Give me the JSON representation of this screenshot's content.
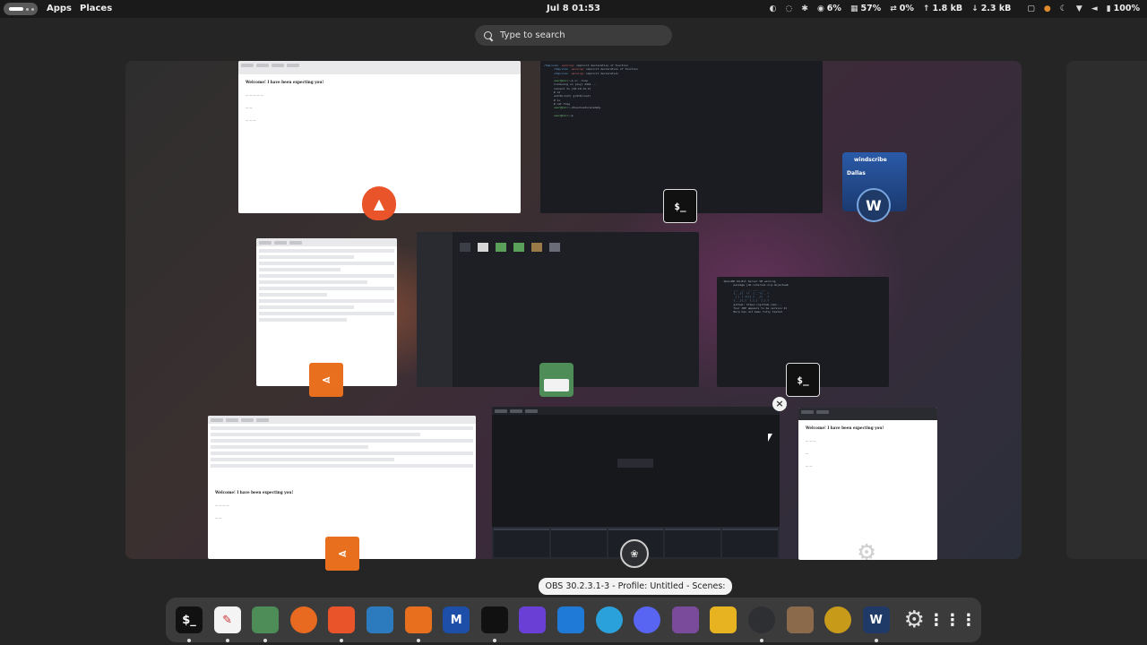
{
  "topbar": {
    "apps_label": "Apps",
    "places_label": "Places",
    "clock": "Jul 8  01:53",
    "tray": {
      "cpu": "6%",
      "mem": "57%",
      "swap": "0%",
      "net_up": "1.8 kB",
      "net_down": "2.3 kB",
      "battery": "100%"
    }
  },
  "search": {
    "placeholder": "Type to search"
  },
  "windows": {
    "brave_top": {
      "heading": "Welcome! I have been expecting you!"
    },
    "term_top": {
      "prompt_glyph": "$_"
    },
    "windscribe": {
      "brand": "windscribe",
      "location": "Dallas"
    },
    "term_burp": {
      "prompt_glyph": "$_"
    },
    "firefox_bottom": {
      "heading": "Welcome! I have been expecting you!"
    },
    "brave_right": {
      "heading": "Welcome! I have been expecting you!"
    }
  },
  "tooltip": "OBS 30.2.3.1-3 - Profile: Untitled - Scenes: Untitled",
  "dock": {
    "items": [
      {
        "name": "terminal",
        "glyph": "$_",
        "color": "#111111"
      },
      {
        "name": "text-editor",
        "glyph": "",
        "color": "#f4f4f4"
      },
      {
        "name": "files",
        "glyph": "",
        "color": "#4e8c58"
      },
      {
        "name": "firefox",
        "glyph": "",
        "color": "#e76a20"
      },
      {
        "name": "brave",
        "glyph": "",
        "color": "#e9542a"
      },
      {
        "name": "wireshark",
        "glyph": "",
        "color": "#2d7bbf"
      },
      {
        "name": "burp-suite-ce",
        "glyph": "",
        "color": "#e86f1d"
      },
      {
        "name": "maltego",
        "glyph": "M",
        "color": "#1d4fa8"
      },
      {
        "name": "burp-suite",
        "glyph": "",
        "color": "#111111"
      },
      {
        "name": "burp-pro",
        "glyph": "",
        "color": "#6a3fd6"
      },
      {
        "name": "vscode",
        "glyph": "",
        "color": "#1e7ad6"
      },
      {
        "name": "telegram",
        "glyph": "",
        "color": "#2aa1da"
      },
      {
        "name": "discord",
        "glyph": "",
        "color": "#5865f2"
      },
      {
        "name": "tor-browser",
        "glyph": "",
        "color": "#7a4b9a"
      },
      {
        "name": "virtual-machine-manager",
        "glyph": "",
        "color": "#e8b320"
      },
      {
        "name": "obs-studio",
        "glyph": "",
        "color": "#2e2f33"
      },
      {
        "name": "portrait-app",
        "glyph": "",
        "color": "#8a6a4a"
      },
      {
        "name": "radial-app",
        "glyph": "",
        "color": "#c89a1a"
      },
      {
        "name": "windscribe",
        "glyph": "W",
        "color": "#1f3a66"
      },
      {
        "name": "settings",
        "glyph": "",
        "color": "#9a9a9a"
      },
      {
        "name": "show-apps",
        "glyph": "",
        "color": "#3b3b3b"
      }
    ]
  }
}
